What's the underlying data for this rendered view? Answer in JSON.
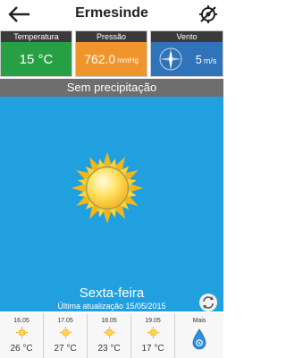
{
  "header": {
    "title": "Ermesinde",
    "back_icon": "arrow-left-icon",
    "location_icon": "location-off-icon"
  },
  "metrics": {
    "temperature": {
      "label": "Temperatura",
      "value": "15 °C",
      "color": "#27a045"
    },
    "pressure": {
      "label": "Pressão",
      "value": "762.0",
      "unit": "mmHg",
      "color": "#f0952b"
    },
    "wind": {
      "label": "Vento",
      "value": "5",
      "unit": "m/s",
      "icon": "compass-icon",
      "color": "#2f73b9"
    }
  },
  "condition": "Sem precipitação",
  "main": {
    "day": "Sexta-feira",
    "updated": "Última atualização 15/05/2015",
    "weather_icon": "sun-icon",
    "sky_color": "#21a0df"
  },
  "forecast": [
    {
      "date": "16.05",
      "temp": "26 °C",
      "icon": "sun-icon"
    },
    {
      "date": "17.05",
      "temp": "27 °C",
      "icon": "sun-icon"
    },
    {
      "date": "18.05",
      "temp": "23 °C",
      "icon": "sun-icon"
    },
    {
      "date": "19.05",
      "temp": "17 °C",
      "icon": "sun-icon"
    }
  ],
  "more": {
    "label": "Mais",
    "icon": "raindrop-icon"
  }
}
